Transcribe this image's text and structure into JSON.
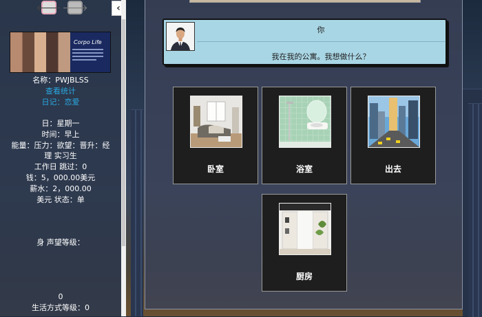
{
  "nav": {
    "back_icon": "arrow-left-icon",
    "forward_icon": "arrow-right-icon",
    "collapse_icon": "chevron-left-icon"
  },
  "banner": {
    "title": "Corpo Life"
  },
  "sidebar": {
    "name_line": "名称：PWJBLSS",
    "stats_link": "查看统计",
    "diary_link": "日记：恋爱",
    "day": "日：星期一",
    "time": "时间：早上",
    "energy_line": "能量：压力：欲望：晋升：经",
    "rank_line": "理 实习生",
    "workday_line": "工作日 跳过：0",
    "money_line": "钱：5，000.00美元",
    "salary_line": "薪水：2，000.00",
    "status_line": "美元 状态：单",
    "reputation_line": "身 声望等级：",
    "zero_line": "0",
    "lifestyle_line": "生活方式等级：0"
  },
  "dialog": {
    "speaker": "你",
    "text": "我在我的公寓。我想做什么？"
  },
  "locations": [
    {
      "label": "卧室"
    },
    {
      "label": "浴室"
    },
    {
      "label": "出去"
    },
    {
      "label": "厨房"
    }
  ],
  "colors": {
    "link": "#2aa8e0",
    "dialog_bg": "#a9d6e5",
    "card_bg": "#1e1e1e"
  }
}
